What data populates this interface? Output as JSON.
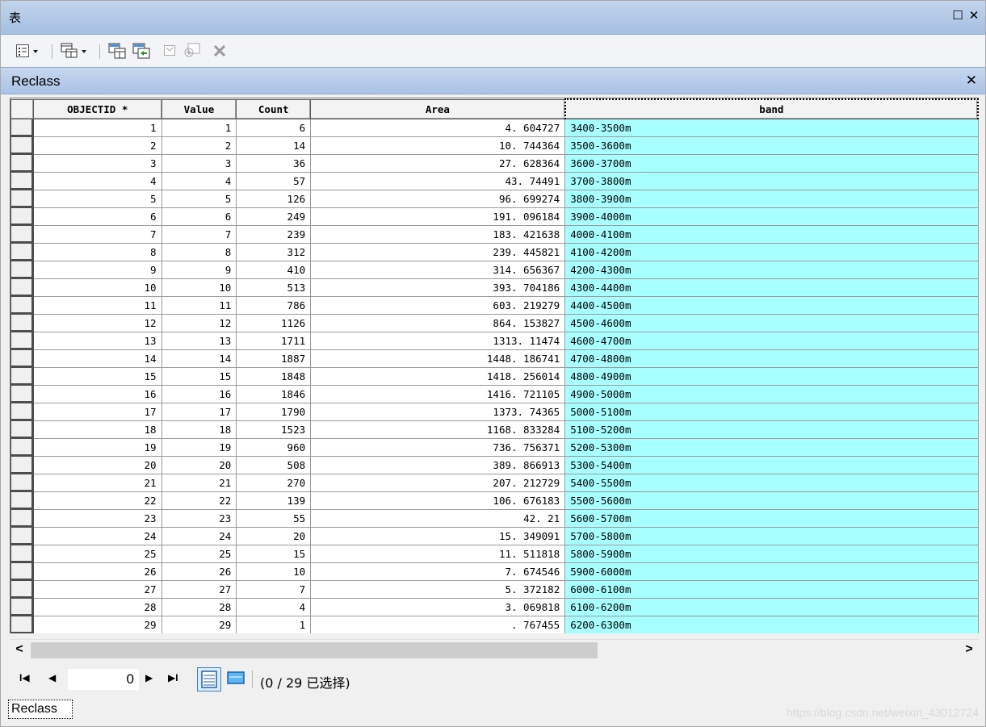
{
  "window": {
    "title": "表",
    "restore_label": "☐",
    "close_label": "✕"
  },
  "table_caption": {
    "name": "Reclass",
    "close_label": "✕"
  },
  "columns": [
    {
      "label": "OBJECTID *"
    },
    {
      "label": "Value"
    },
    {
      "label": "Count"
    },
    {
      "label": "Area"
    },
    {
      "label": "band"
    }
  ],
  "rows": [
    {
      "objectid": "1",
      "value": "1",
      "count": "6",
      "area": "4. 604727",
      "band": "3400-3500m"
    },
    {
      "objectid": "2",
      "value": "2",
      "count": "14",
      "area": "10. 744364",
      "band": "3500-3600m"
    },
    {
      "objectid": "3",
      "value": "3",
      "count": "36",
      "area": "27. 628364",
      "band": "3600-3700m"
    },
    {
      "objectid": "4",
      "value": "4",
      "count": "57",
      "area": "43. 74491",
      "band": "3700-3800m"
    },
    {
      "objectid": "5",
      "value": "5",
      "count": "126",
      "area": "96. 699274",
      "band": "3800-3900m"
    },
    {
      "objectid": "6",
      "value": "6",
      "count": "249",
      "area": "191. 096184",
      "band": "3900-4000m"
    },
    {
      "objectid": "7",
      "value": "7",
      "count": "239",
      "area": "183. 421638",
      "band": "4000-4100m"
    },
    {
      "objectid": "8",
      "value": "8",
      "count": "312",
      "area": "239. 445821",
      "band": "4100-4200m"
    },
    {
      "objectid": "9",
      "value": "9",
      "count": "410",
      "area": "314. 656367",
      "band": "4200-4300m"
    },
    {
      "objectid": "10",
      "value": "10",
      "count": "513",
      "area": "393. 704186",
      "band": "4300-4400m"
    },
    {
      "objectid": "11",
      "value": "11",
      "count": "786",
      "area": "603. 219279",
      "band": "4400-4500m"
    },
    {
      "objectid": "12",
      "value": "12",
      "count": "1126",
      "area": "864. 153827",
      "band": "4500-4600m"
    },
    {
      "objectid": "13",
      "value": "13",
      "count": "1711",
      "area": "1313. 11474",
      "band": "4600-4700m"
    },
    {
      "objectid": "14",
      "value": "14",
      "count": "1887",
      "area": "1448. 186741",
      "band": "4700-4800m"
    },
    {
      "objectid": "15",
      "value": "15",
      "count": "1848",
      "area": "1418. 256014",
      "band": "4800-4900m"
    },
    {
      "objectid": "16",
      "value": "16",
      "count": "1846",
      "area": "1416. 721105",
      "band": "4900-5000m"
    },
    {
      "objectid": "17",
      "value": "17",
      "count": "1790",
      "area": "1373. 74365",
      "band": "5000-5100m"
    },
    {
      "objectid": "18",
      "value": "18",
      "count": "1523",
      "area": "1168. 833284",
      "band": "5100-5200m"
    },
    {
      "objectid": "19",
      "value": "19",
      "count": "960",
      "area": "736. 756371",
      "band": "5200-5300m"
    },
    {
      "objectid": "20",
      "value": "20",
      "count": "508",
      "area": "389. 866913",
      "band": "5300-5400m"
    },
    {
      "objectid": "21",
      "value": "21",
      "count": "270",
      "area": "207. 212729",
      "band": "5400-5500m"
    },
    {
      "objectid": "22",
      "value": "22",
      "count": "139",
      "area": "106. 676183",
      "band": "5500-5600m"
    },
    {
      "objectid": "23",
      "value": "23",
      "count": "55",
      "area": "42. 21",
      "band": "5600-5700m"
    },
    {
      "objectid": "24",
      "value": "24",
      "count": "20",
      "area": "15. 349091",
      "band": "5700-5800m"
    },
    {
      "objectid": "25",
      "value": "25",
      "count": "15",
      "area": "11. 511818",
      "band": "5800-5900m"
    },
    {
      "objectid": "26",
      "value": "26",
      "count": "10",
      "area": "7. 674546",
      "band": "5900-6000m"
    },
    {
      "objectid": "27",
      "value": "27",
      "count": "7",
      "area": "5. 372182",
      "band": "6000-6100m"
    },
    {
      "objectid": "28",
      "value": "28",
      "count": "4",
      "area": "3. 069818",
      "band": "6100-6200m"
    },
    {
      "objectid": "29",
      "value": "29",
      "count": "1",
      "area": ". 767455",
      "band": "6200-6300m"
    }
  ],
  "scrollbar": {
    "left_label": "<",
    "right_label": ">"
  },
  "navigation": {
    "first_label": "I◀",
    "prev_label": "◀",
    "record_value": "0",
    "next_label": "▶",
    "last_label": "▶I",
    "selection_text": "(0 / 29 已选择)"
  },
  "bottom_tab": {
    "label": "Reclass"
  },
  "watermark": "https://blog.csdn.net/weixin_43012724",
  "colors": {
    "title_bar": "#b3c9e8",
    "band_cell": "#a8ffff",
    "header_cell": "#f3f3f3"
  }
}
